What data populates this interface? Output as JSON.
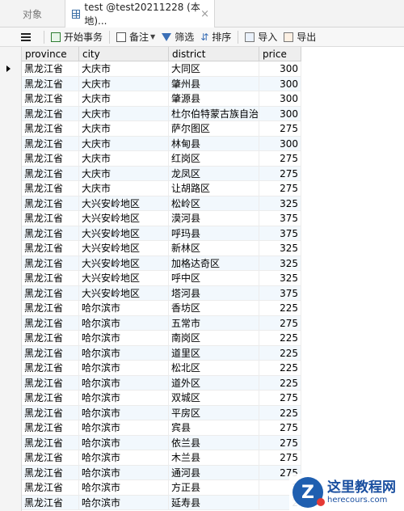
{
  "tabs": {
    "objects_label": "对象",
    "active_label": "test @test20211228 (本地)...",
    "close_symbol": "×"
  },
  "toolbar": {
    "begin_transaction": "开始事务",
    "note": "备注",
    "filter": "筛选",
    "sort": "排序",
    "import": "导入",
    "export": "导出"
  },
  "columns": [
    "province",
    "city",
    "district",
    "price"
  ],
  "rows": [
    [
      "黑龙江省",
      "大庆市",
      "大同区",
      "300"
    ],
    [
      "黑龙江省",
      "大庆市",
      "肇州县",
      "300"
    ],
    [
      "黑龙江省",
      "大庆市",
      "肇源县",
      "300"
    ],
    [
      "黑龙江省",
      "大庆市",
      "杜尔伯特蒙古族自治县",
      "300"
    ],
    [
      "黑龙江省",
      "大庆市",
      "萨尔图区",
      "275"
    ],
    [
      "黑龙江省",
      "大庆市",
      "林甸县",
      "300"
    ],
    [
      "黑龙江省",
      "大庆市",
      "红岗区",
      "275"
    ],
    [
      "黑龙江省",
      "大庆市",
      "龙凤区",
      "275"
    ],
    [
      "黑龙江省",
      "大庆市",
      "让胡路区",
      "275"
    ],
    [
      "黑龙江省",
      "大兴安岭地区",
      "松岭区",
      "325"
    ],
    [
      "黑龙江省",
      "大兴安岭地区",
      "漠河县",
      "375"
    ],
    [
      "黑龙江省",
      "大兴安岭地区",
      "呼玛县",
      "375"
    ],
    [
      "黑龙江省",
      "大兴安岭地区",
      "新林区",
      "325"
    ],
    [
      "黑龙江省",
      "大兴安岭地区",
      "加格达奇区",
      "325"
    ],
    [
      "黑龙江省",
      "大兴安岭地区",
      "呼中区",
      "325"
    ],
    [
      "黑龙江省",
      "大兴安岭地区",
      "塔河县",
      "375"
    ],
    [
      "黑龙江省",
      "哈尔滨市",
      "香坊区",
      "225"
    ],
    [
      "黑龙江省",
      "哈尔滨市",
      "五常市",
      "275"
    ],
    [
      "黑龙江省",
      "哈尔滨市",
      "南岗区",
      "225"
    ],
    [
      "黑龙江省",
      "哈尔滨市",
      "道里区",
      "225"
    ],
    [
      "黑龙江省",
      "哈尔滨市",
      "松北区",
      "225"
    ],
    [
      "黑龙江省",
      "哈尔滨市",
      "道外区",
      "225"
    ],
    [
      "黑龙江省",
      "哈尔滨市",
      "双城区",
      "275"
    ],
    [
      "黑龙江省",
      "哈尔滨市",
      "平房区",
      "225"
    ],
    [
      "黑龙江省",
      "哈尔滨市",
      "宾县",
      "275"
    ],
    [
      "黑龙江省",
      "哈尔滨市",
      "依兰县",
      "275"
    ],
    [
      "黑龙江省",
      "哈尔滨市",
      "木兰县",
      "275"
    ],
    [
      "黑龙江省",
      "哈尔滨市",
      "通河县",
      "275"
    ],
    [
      "黑龙江省",
      "哈尔滨市",
      "方正县",
      "2"
    ],
    [
      "黑龙江省",
      "哈尔滨市",
      "延寿县",
      "2"
    ]
  ],
  "watermark": {
    "title": "这里教程网",
    "subtitle": "herecours.com",
    "logo_letter": "Z"
  },
  "colors": {
    "alt_row": "#f2f8fd",
    "accent": "#1f5fb0"
  }
}
